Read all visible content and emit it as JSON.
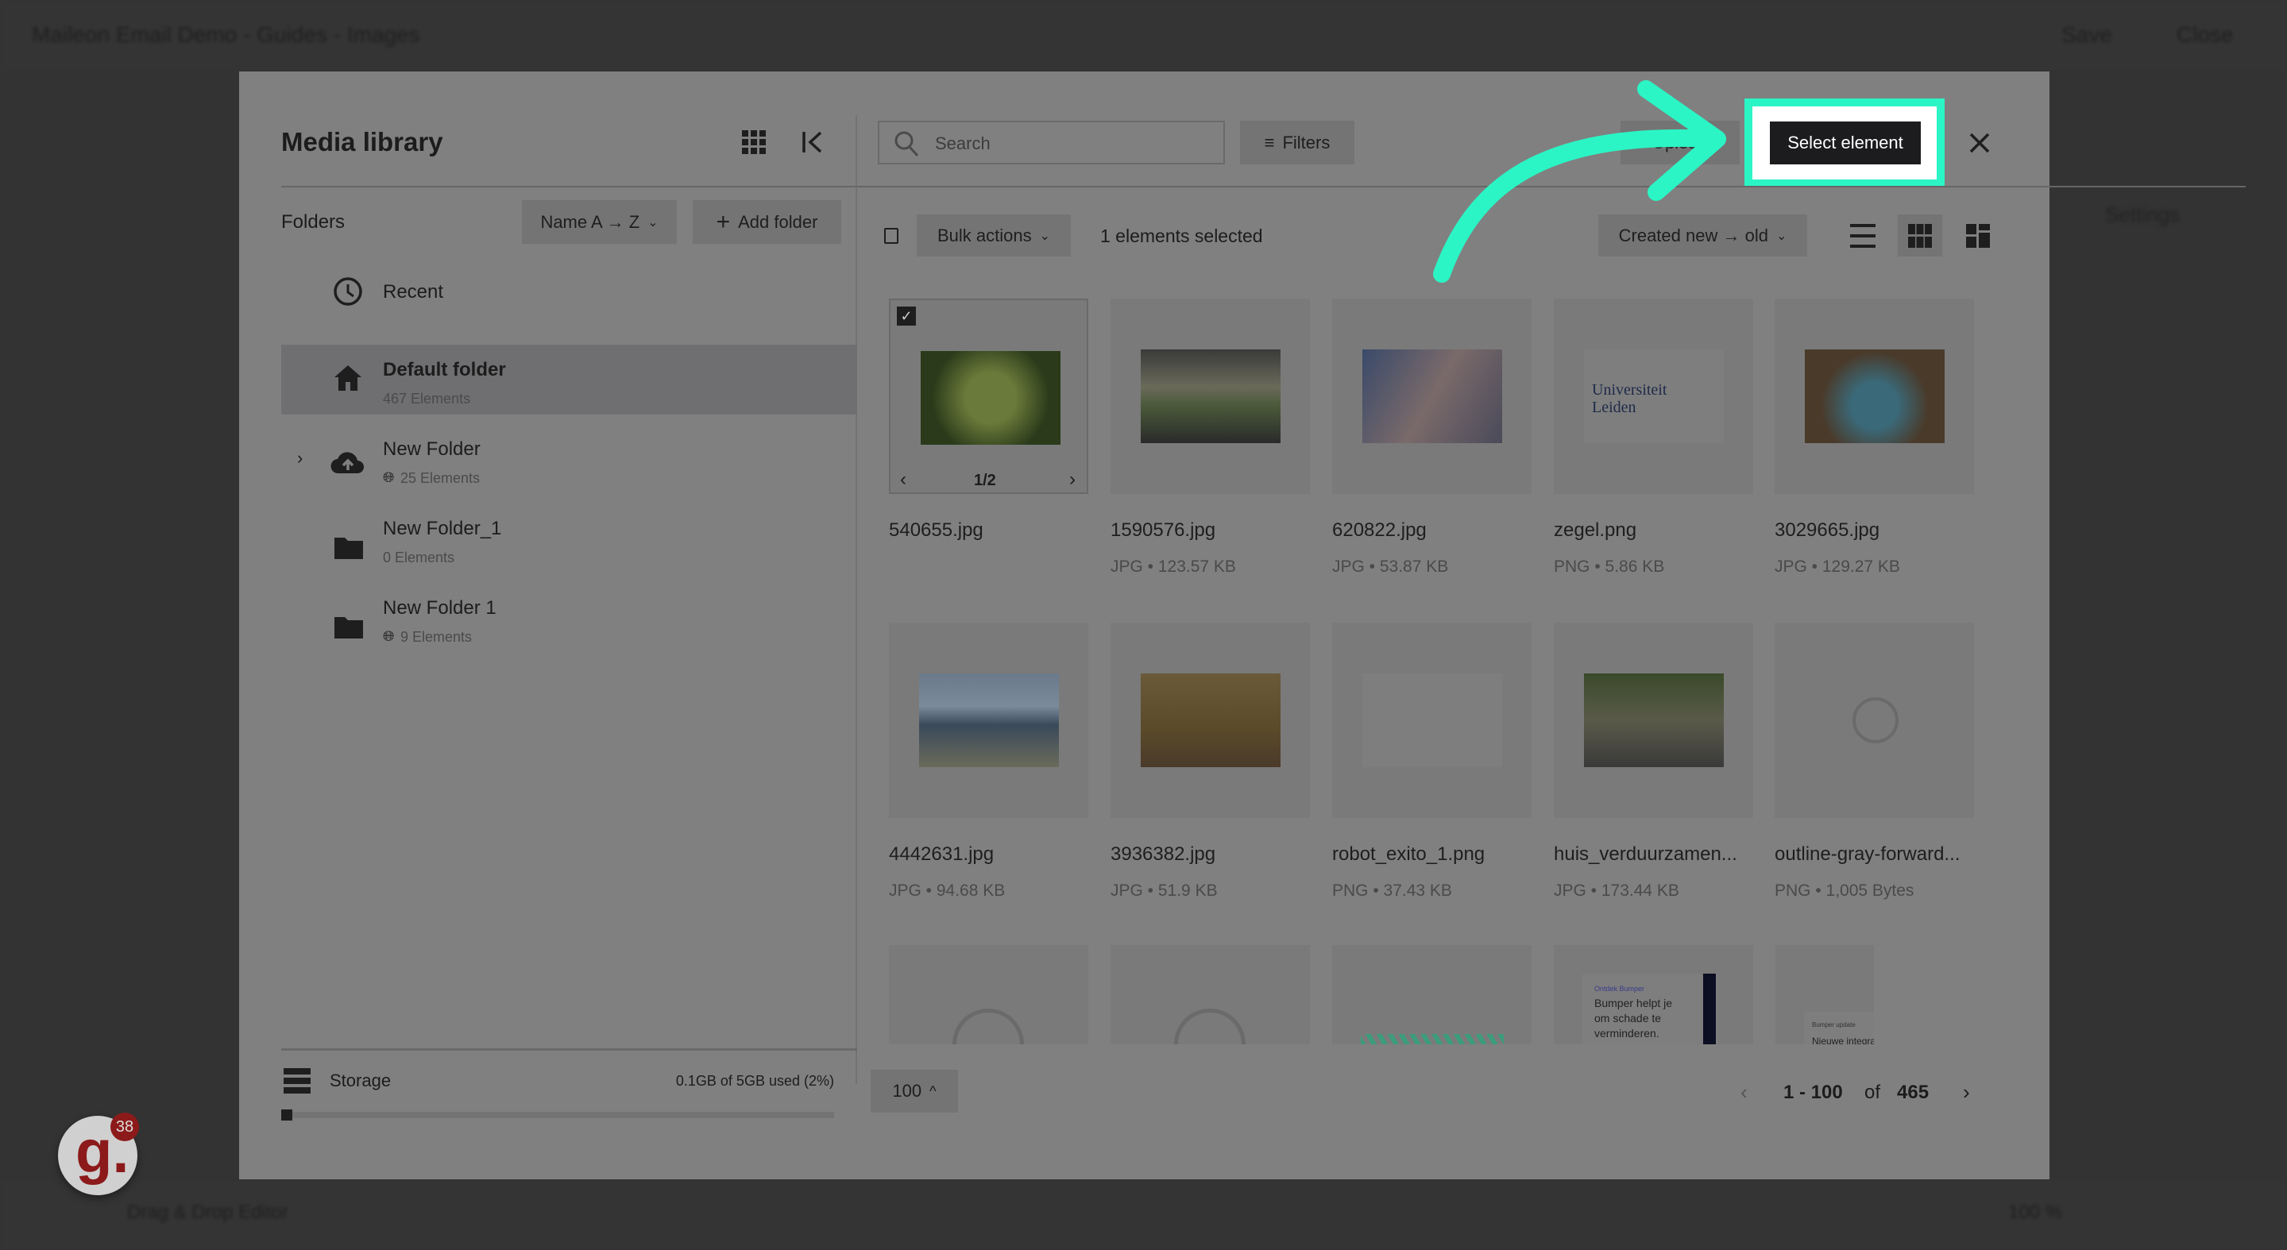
{
  "app": {
    "title": "Maileon Email Demo - Guides - Images",
    "save": "Save",
    "close": "Close",
    "settings": "Settings",
    "editor_mode": "Drag & Drop Editor",
    "zoom": "100 %",
    "badge_count": "38"
  },
  "sidebar": {
    "title": "Media library",
    "folders_label": "Folders",
    "sort_label": "Name A → Z",
    "add_folder": "Add folder",
    "items": [
      {
        "name": "Recent",
        "icon": "clock-icon"
      },
      {
        "name": "Default folder",
        "count": "467 Elements",
        "icon": "home-icon",
        "selected": true
      },
      {
        "name": "New Folder",
        "count": "25 Elements",
        "icon": "cloud-upload-icon",
        "shared": true,
        "expandable": true
      },
      {
        "name": "New Folder_1",
        "count": "0 Elements",
        "icon": "folder-icon"
      },
      {
        "name": "New Folder 1",
        "count": "9 Elements",
        "icon": "folder-icon",
        "shared": true
      }
    ],
    "storage": {
      "label": "Storage",
      "usage": "0.1GB of 5GB used (2%)",
      "percent": 2
    }
  },
  "toolbar": {
    "search_placeholder": "Search",
    "filters": "Filters",
    "upload": "Upload",
    "select_element": "Select element",
    "bulk_actions": "Bulk actions",
    "selected_count": "1 elements selected",
    "sort": "Created new → old"
  },
  "files": [
    {
      "name": "540655.jpg",
      "meta": "",
      "checked": true,
      "pager": "1/2"
    },
    {
      "name": "1590576.jpg",
      "meta": "JPG • 123.57 KB"
    },
    {
      "name": "620822.jpg",
      "meta": "JPG • 53.87 KB"
    },
    {
      "name": "zegel.png",
      "meta": "PNG • 5.86 KB",
      "logo_text": "Universiteit Leiden"
    },
    {
      "name": "3029665.jpg",
      "meta": "JPG • 129.27 KB"
    },
    {
      "name": "4442631.jpg",
      "meta": "JPG • 94.68 KB"
    },
    {
      "name": "3936382.jpg",
      "meta": "JPG • 51.9 KB"
    },
    {
      "name": "robot_exito_1.png",
      "meta": "PNG • 37.43 KB"
    },
    {
      "name": "huis_verduurzamen...",
      "meta": "JPG • 173.44 KB"
    },
    {
      "name": "outline-gray-forward...",
      "meta": "PNG • 1,005 Bytes"
    }
  ],
  "row3": {
    "banner1_small": "Ontdek Bumper",
    "banner1": "Bumper helpt je om schade te verminderen.",
    "banner2_small": "Bumper update",
    "banner2": "Nieuwe integratie"
  },
  "pagination": {
    "per_page": "100",
    "range": "1 - 100",
    "of": "of",
    "total": "465"
  },
  "colors": {
    "accent": "#2bf5c5",
    "overlay_bg": "#333333",
    "modal_dimmed": "#808080"
  }
}
